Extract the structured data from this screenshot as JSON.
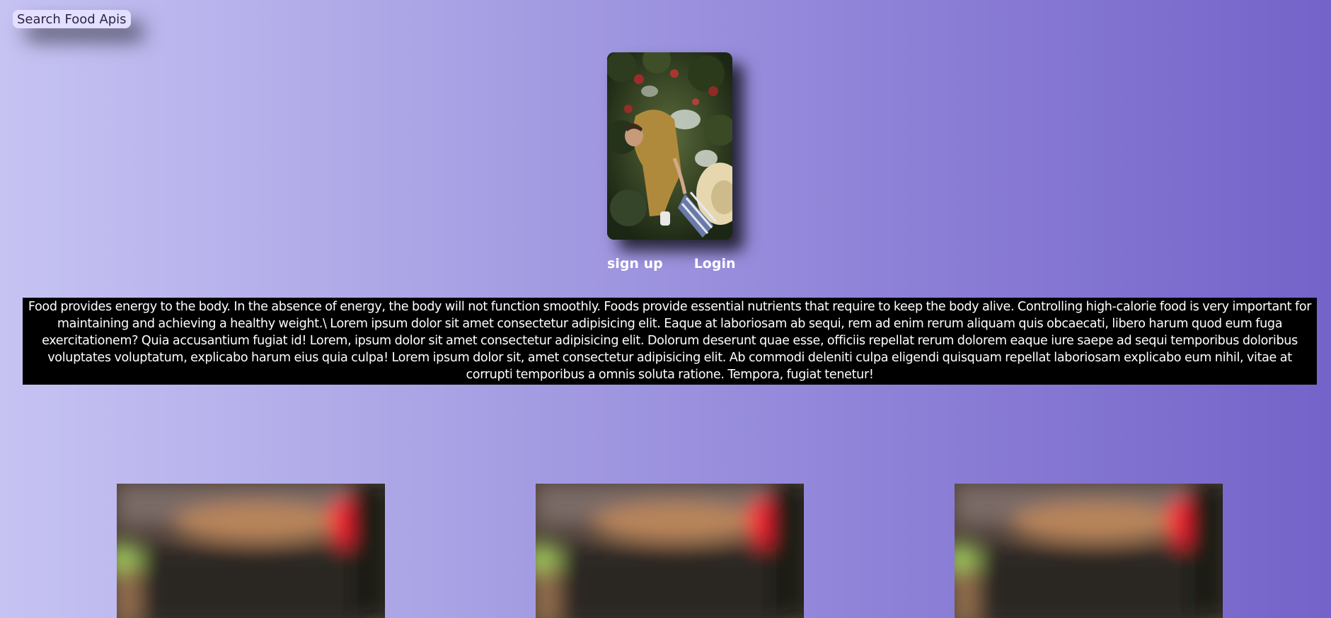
{
  "search": {
    "label": "Search Food Apis"
  },
  "hero": {
    "image": "person-picking-apples-photo"
  },
  "auth": {
    "signup_label": "sign up",
    "login_label": "Login"
  },
  "intro": {
    "text": "Food provides energy to the body. In the absence of energy, the body will not function smoothly. Foods provide essential nutrients that require to keep the body alive. Controlling high-calorie food is very important for maintaining and achieving a healthy weight.\\ Lorem ipsum dolor sit amet consectetur adipisicing elit. Eaque at laboriosam ab sequi, rem ad enim rerum aliquam quis obcaecati, libero harum quod eum fuga exercitationem? Quia accusantium fugiat id! Lorem, ipsum dolor sit amet consectetur adipisicing elit. Dolorum deserunt quae esse, officiis repellat rerum dolorem eaque iure saepe ad sequi temporibus doloribus voluptates voluptatum, explicabo harum eius quia culpa! Lorem ipsum dolor sit, amet consectetur adipisicing elit. Ab commodi deleniti culpa eligendi quisquam repellat laboriosam explicabo eum nihil, vitae at corrupti temporibus a omnis soluta ratione. Tempora, fugiat tenetur!"
  },
  "gallery": {
    "items": [
      {
        "image": "blurred-food-photo"
      },
      {
        "image": "blurred-food-photo"
      },
      {
        "image": "blurred-food-photo"
      }
    ]
  },
  "colors": {
    "background_start": "#c6c3f3",
    "background_end": "#7463c9",
    "text_block_bg": "#000000",
    "text_color": "#ffffff"
  }
}
